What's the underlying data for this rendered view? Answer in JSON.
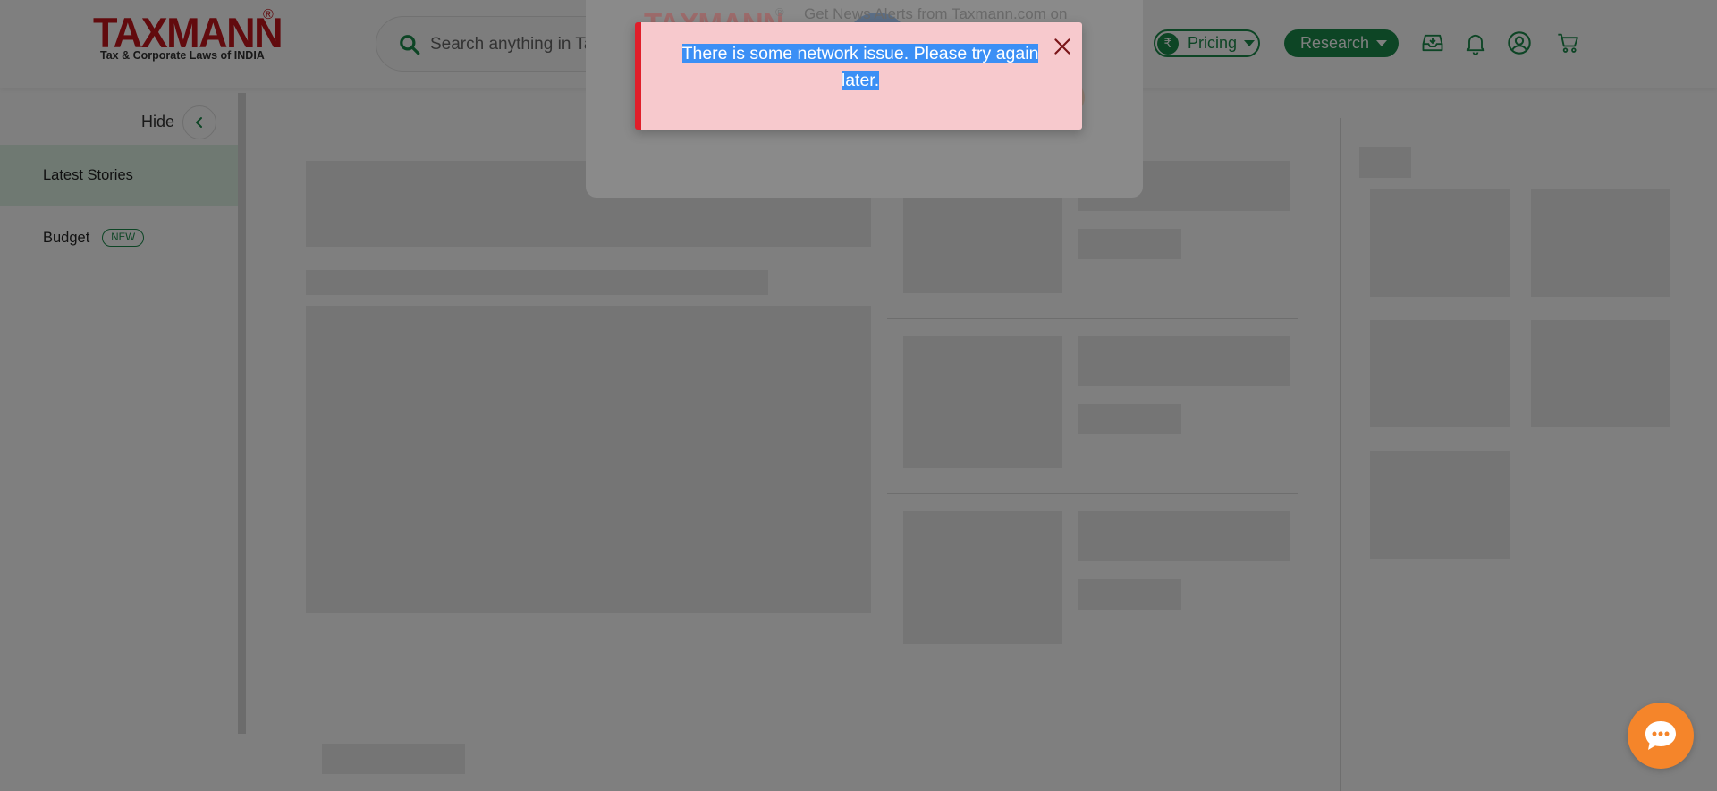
{
  "header": {
    "logo_text": "TAXMANN",
    "logo_reg": "®",
    "logo_tagline": "Tax & Corporate Laws of INDIA",
    "search_placeholder": "Search anything in Taxmann",
    "pricing_label": "Pricing",
    "rupee_symbol": "₹",
    "research_label": "Research",
    "icons": [
      "inbox-icon",
      "bell-icon",
      "user-icon",
      "cart-icon"
    ]
  },
  "sidebar": {
    "hide_label": "Hide",
    "items": [
      {
        "label": "Latest Stories",
        "active": true
      },
      {
        "label": "Budget",
        "badge": "NEW"
      }
    ]
  },
  "modal": {
    "logo_text": "TAXMANN",
    "logo_reg": "®",
    "text": "Get News Alerts from Taxmann.com on"
  },
  "toast": {
    "message_line1": "There is some network issue. Please try again",
    "message_line2": "later."
  },
  "colors": {
    "brand_red": "#c4161c",
    "brand_green": "#1a8a4a",
    "toast_bg": "#f7c9cd",
    "toast_border": "#e01e2a",
    "chat_orange": "#f5852a"
  }
}
